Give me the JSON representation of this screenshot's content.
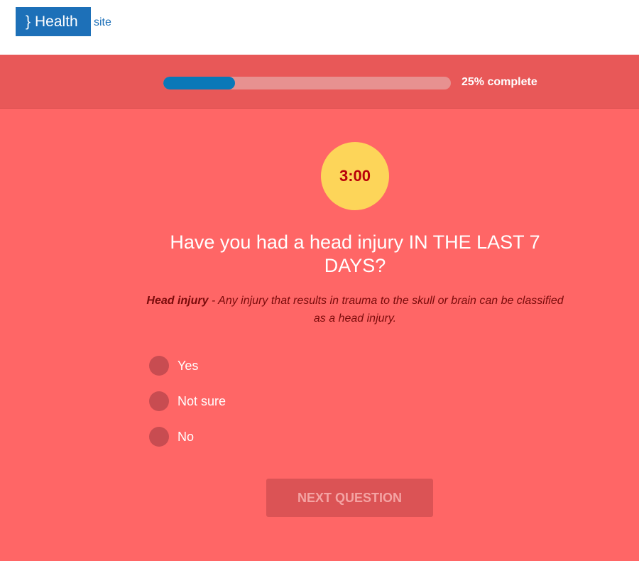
{
  "header": {
    "brace": "}",
    "logo_text": "Health",
    "site_label": "site"
  },
  "progress": {
    "percent": 25,
    "label": "25% complete"
  },
  "timer": {
    "value": "3:00"
  },
  "question": {
    "text": "Have you had a head injury IN THE LAST 7 DAYS?",
    "definition_term": "Head injury",
    "definition_text": " - Any injury that results in trauma to the skull or brain can be classified as a head injury."
  },
  "options": [
    {
      "label": "Yes"
    },
    {
      "label": "Not sure"
    },
    {
      "label": "No"
    }
  ],
  "buttons": {
    "next_label": "NEXT QUESTION"
  },
  "colors": {
    "brand_blue": "#1d70b8",
    "page_background": "#ff6666",
    "progress_fill": "#0a78b8",
    "timer_background": "#fdd559",
    "timer_text": "#b8000a"
  }
}
